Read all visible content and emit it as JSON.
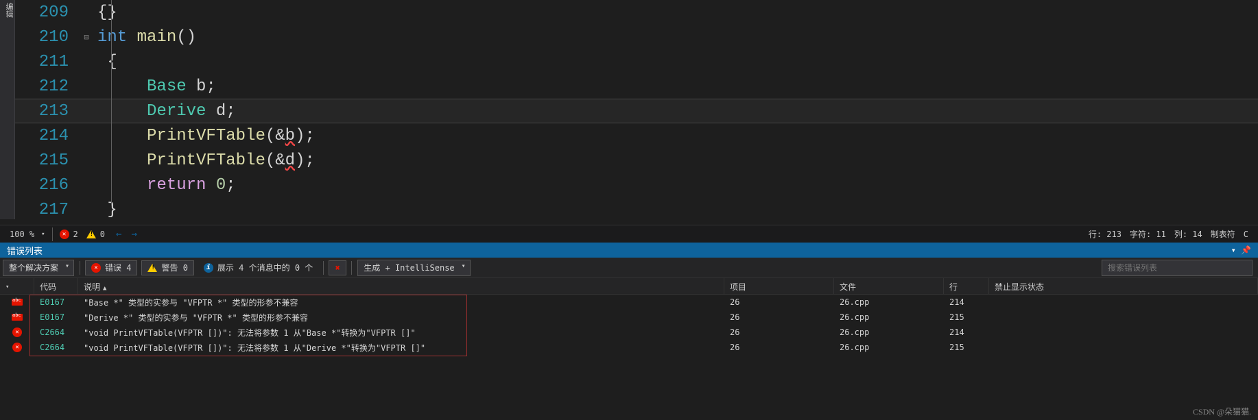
{
  "sidebar": {
    "label": "编辑"
  },
  "code": {
    "lines": [
      {
        "n": 209,
        "fold": "",
        "html": "<span class='brace'>{}</span>"
      },
      {
        "n": 210,
        "fold": "⊟",
        "html": "<span class='kw'>int</span> <span class='fn'>main</span><span class='punc'>()</span>"
      },
      {
        "n": 211,
        "fold": "",
        "html": " <span class='brace'>{</span>"
      },
      {
        "n": 212,
        "fold": "",
        "html": "     <span class='cls'>Base</span> <span class='var'>b</span><span class='punc'>;</span>"
      },
      {
        "n": 213,
        "fold": "",
        "html": "     <span class='cls'>Derive</span> <span class='var'>d</span><span class='punc'>;</span>",
        "hl": true
      },
      {
        "n": 214,
        "fold": "",
        "html": "     <span class='fn'>PrintVFTable</span><span class='punc'>(</span><span class='op'>&amp;</span><span class='var squiggle'>b</span><span class='punc'>);</span>"
      },
      {
        "n": 215,
        "fold": "",
        "html": "     <span class='fn'>PrintVFTable</span><span class='punc'>(</span><span class='op'>&amp;</span><span class='var squiggle'>d</span><span class='punc'>);</span>"
      },
      {
        "n": 216,
        "fold": "",
        "html": "     <span class='ctl'>return</span> <span class='num'>0</span><span class='punc'>;</span>"
      },
      {
        "n": 217,
        "fold": "",
        "html": " <span class='brace'>}</span>"
      }
    ]
  },
  "status": {
    "zoom": "100 %",
    "err_count": "2",
    "warn_count": "0",
    "line": "行: 213",
    "col": "字符: 11",
    "colpos": "列: 14",
    "tab": "制表符",
    "crlf": "C"
  },
  "panel": {
    "title": "错误列表"
  },
  "toolbar": {
    "scope": "整个解决方案",
    "errors": "错误 4",
    "warnings": "警告 0",
    "messages": "展示 4 个消息中的 0 个",
    "build": "生成 + IntelliSense",
    "search_ph": "搜索错误列表"
  },
  "columns": {
    "icon": "",
    "code": "代码",
    "desc": "说明",
    "proj": "项目",
    "file": "文件",
    "line": "行",
    "supp": "禁止显示状态"
  },
  "errors": [
    {
      "ico": "abc",
      "code": "E0167",
      "desc": "\"Base *\" 类型的实参与 \"VFPTR *\" 类型的形参不兼容",
      "proj": "26",
      "file": "26.cpp",
      "line": "214"
    },
    {
      "ico": "abc",
      "code": "E0167",
      "desc": "\"Derive *\" 类型的实参与 \"VFPTR *\" 类型的形参不兼容",
      "proj": "26",
      "file": "26.cpp",
      "line": "215"
    },
    {
      "ico": "err",
      "code": "C2664",
      "desc": "\"void PrintVFTable(VFPTR [])\": 无法将参数 1 从\"Base *\"转换为\"VFPTR []\"",
      "proj": "26",
      "file": "26.cpp",
      "line": "214"
    },
    {
      "ico": "err",
      "code": "C2664",
      "desc": "\"void PrintVFTable(VFPTR [])\": 无法将参数 1 从\"Derive *\"转换为\"VFPTR []\"",
      "proj": "26",
      "file": "26.cpp",
      "line": "215"
    }
  ],
  "watermark": "CSDN @朵猫猫."
}
